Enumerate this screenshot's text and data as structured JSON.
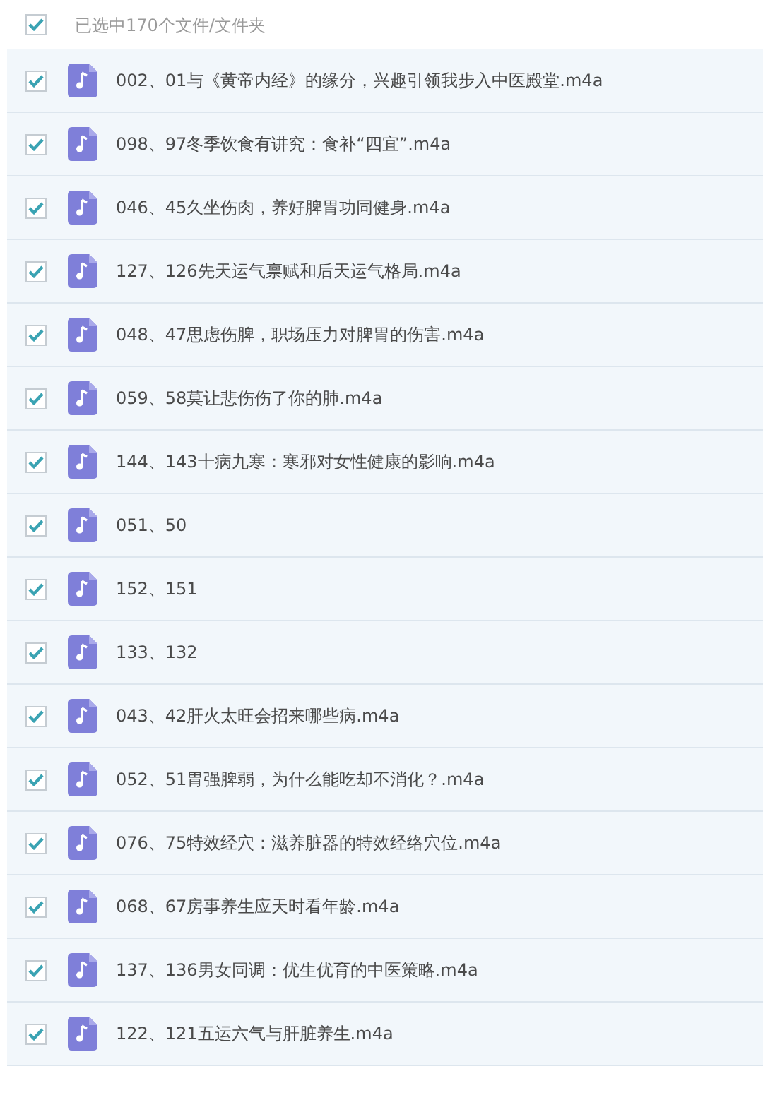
{
  "header": {
    "checked": true,
    "label": "已选中170个文件/文件夹"
  },
  "files": [
    {
      "name": "002、01与《黄帝内经》的缘分，兴趣引领我步入中医殿堂.m4a",
      "checked": true
    },
    {
      "name": "098、97冬季饮食有讲究：食补“四宜”.m4a",
      "checked": true
    },
    {
      "name": "046、45久坐伤肉，养好脾胃功同健身.m4a",
      "checked": true
    },
    {
      "name": "127、126先天运气禀赋和后天运气格局.m4a",
      "checked": true
    },
    {
      "name": "048、47思虑伤脾，职场压力对脾胃的伤害.m4a",
      "checked": true
    },
    {
      "name": "059、58莫让悲伤伤了你的肺.m4a",
      "checked": true
    },
    {
      "name": "144、143十病九寒：寒邪对女性健康的影响.m4a",
      "checked": true
    },
    {
      "name": "051、50",
      "checked": true
    },
    {
      "name": "152、151",
      "checked": true
    },
    {
      "name": "133、132",
      "checked": true
    },
    {
      "name": "043、42肝火太旺会招来哪些病.m4a",
      "checked": true
    },
    {
      "name": "052、51胃强脾弱，为什么能吃却不消化？.m4a",
      "checked": true
    },
    {
      "name": "076、75特效经穴：滋养脏器的特效经络穴位.m4a",
      "checked": true
    },
    {
      "name": "068、67房事养生应天时看年龄.m4a",
      "checked": true
    },
    {
      "name": "137、136男女同调：优生优育的中医策略.m4a",
      "checked": true
    },
    {
      "name": "122、121五运六气与肝脏养生.m4a",
      "checked": true
    }
  ]
}
